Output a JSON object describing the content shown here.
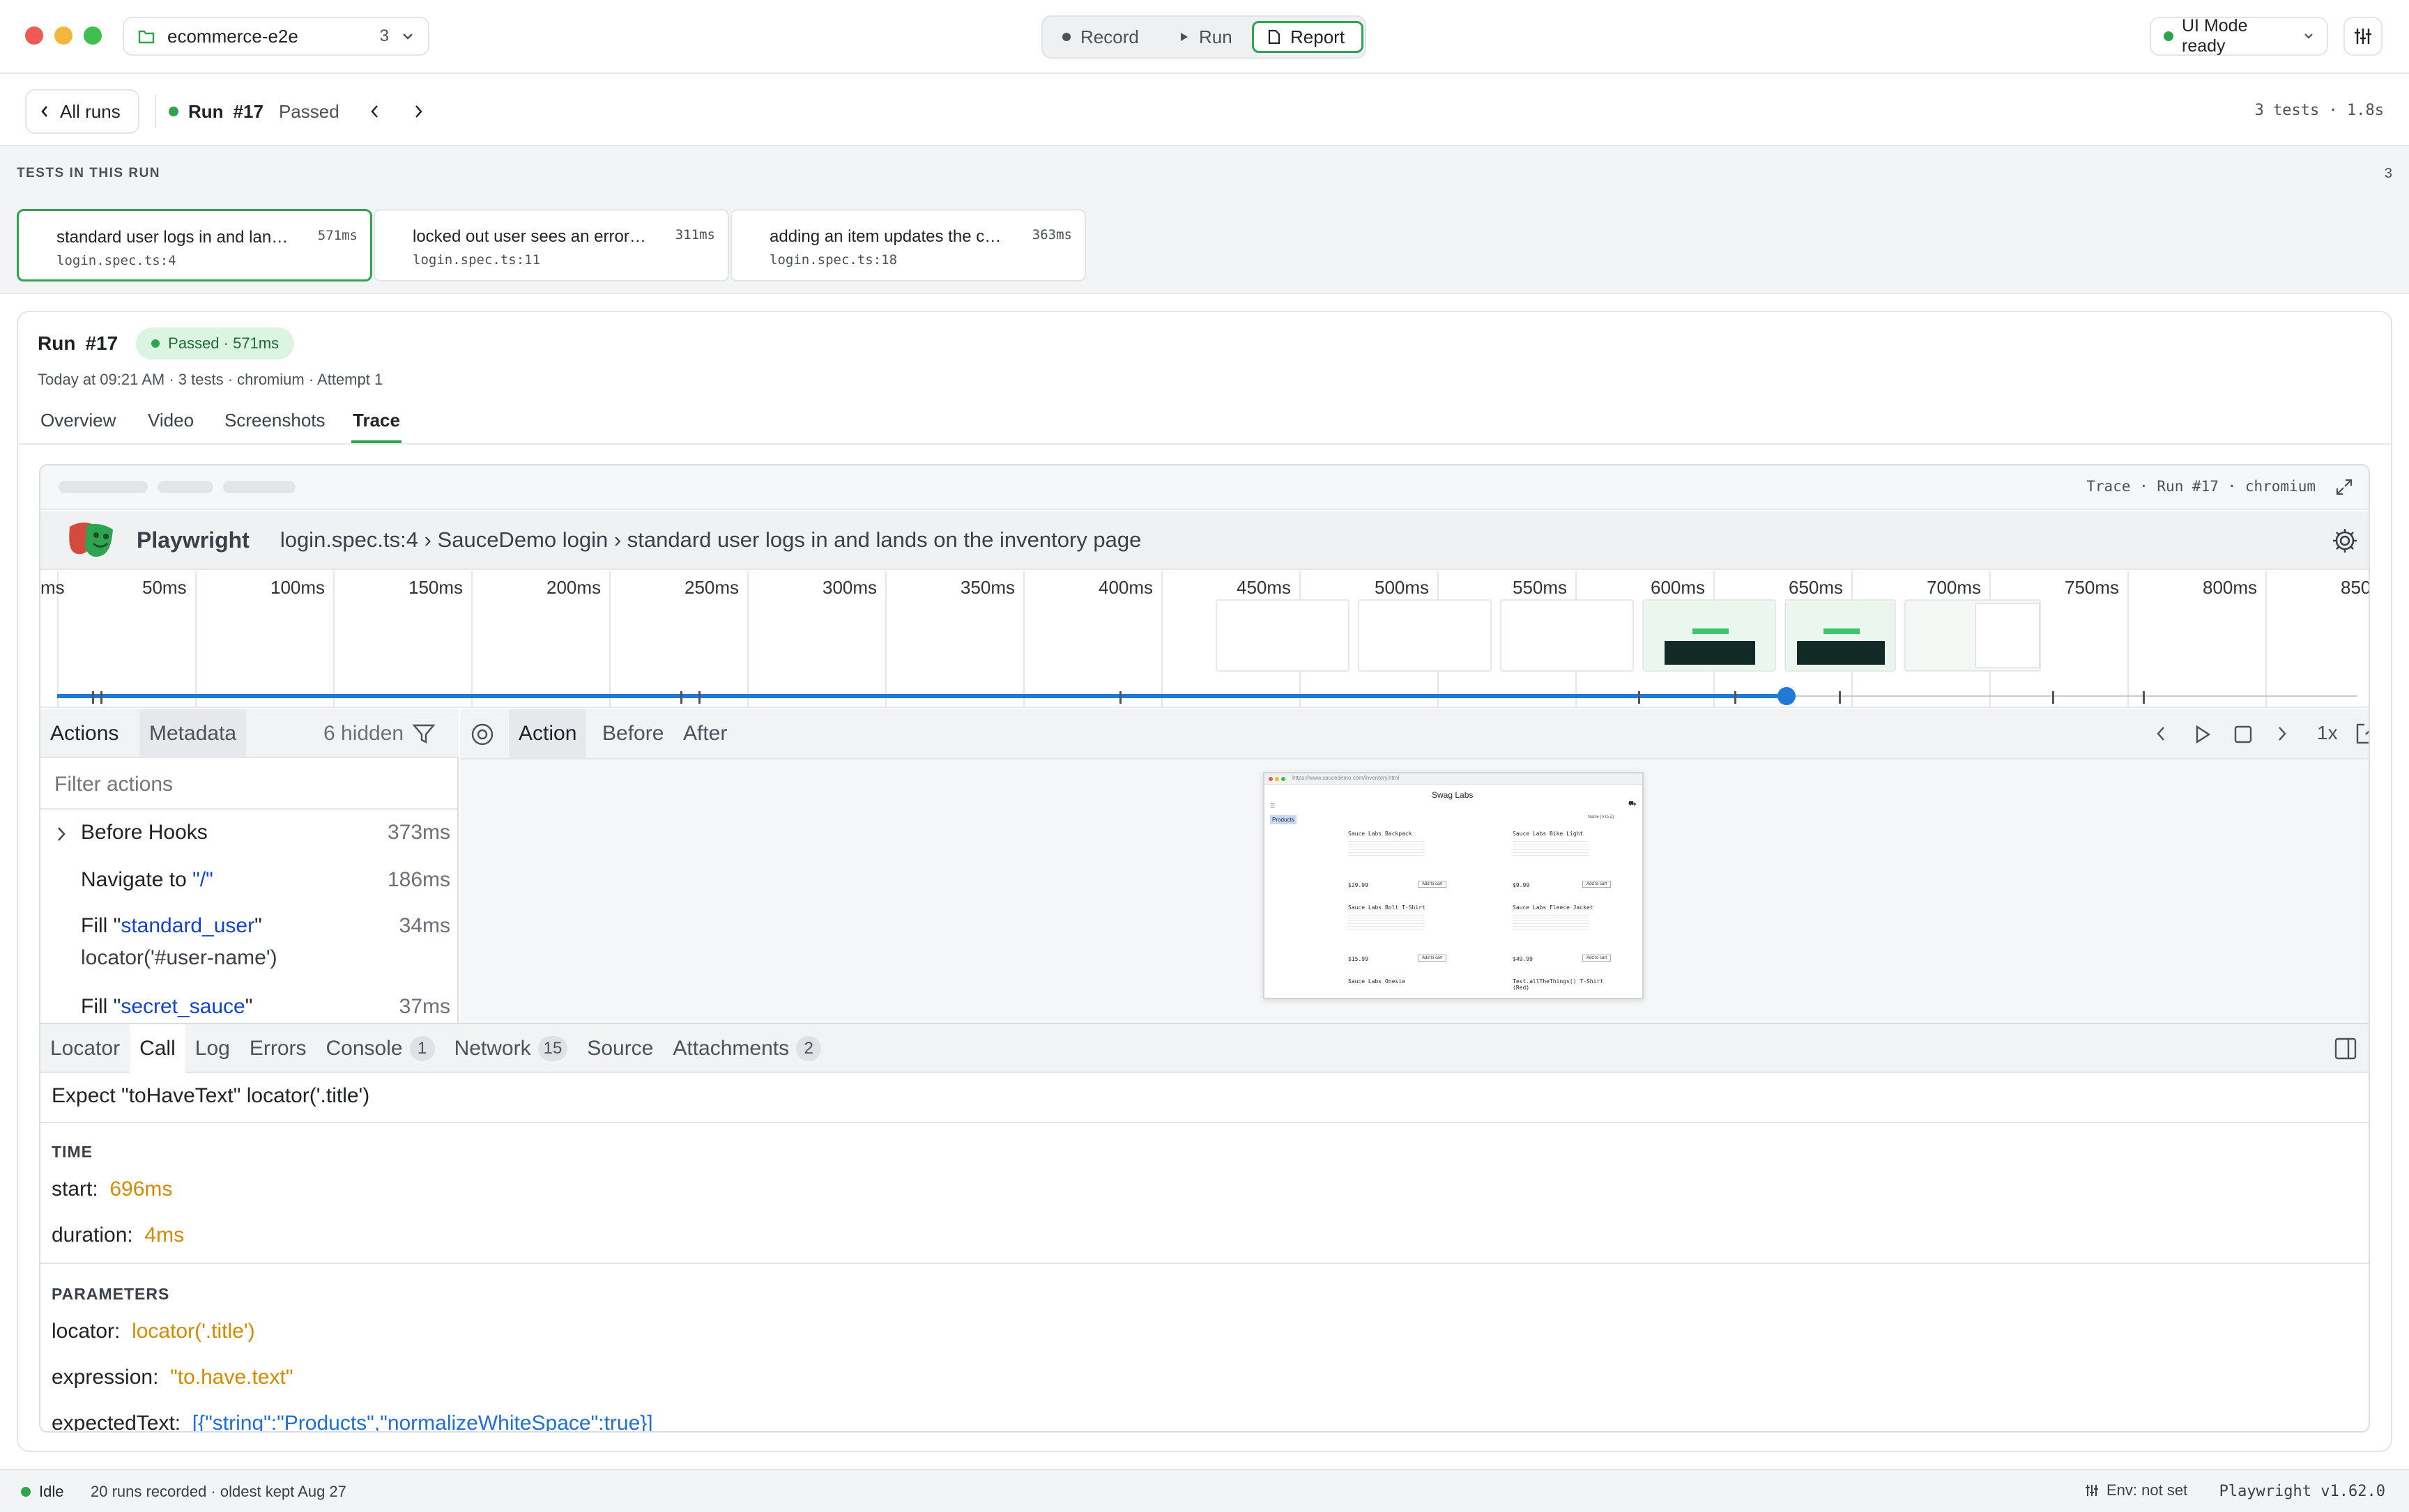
{
  "titlebar": {
    "project_name": "ecommerce-e2e",
    "project_count": "3",
    "modes": {
      "record": "Record",
      "run": "Run",
      "report": "Report"
    },
    "ui_mode": "UI Mode ready"
  },
  "runbar": {
    "back_label": "All runs",
    "run_label": "Run",
    "run_number": "#17",
    "run_status": "Passed",
    "summary": "3 tests · 1.8s"
  },
  "tests_section": {
    "heading": "TESTS IN THIS RUN",
    "count": "3",
    "tests": [
      {
        "name": "standard user logs in and lands on the inventory page",
        "file": "login.spec.ts:4",
        "duration": "571ms"
      },
      {
        "name": "locked out user sees an error message",
        "file": "login.spec.ts:11",
        "duration": "311ms"
      },
      {
        "name": "adding an item updates the cart badge",
        "file": "login.spec.ts:18",
        "duration": "363ms"
      }
    ]
  },
  "run_detail": {
    "title": "Run",
    "number": "#17",
    "badge": "Passed · 571ms",
    "meta": "Today at 09:21 AM · 3 tests · chromium · Attempt 1",
    "tabs": [
      "Overview",
      "Video",
      "Screenshots",
      "Trace"
    ],
    "active_tab": "Trace"
  },
  "trace": {
    "frame_label": "Trace · Run #17 · chromium",
    "app_name": "Playwright",
    "breadcrumb": "login.spec.ts:4 › SauceDemo login › standard user logs in and lands on the inventory page",
    "timeline_labels": [
      "ms",
      "50ms",
      "100ms",
      "150ms",
      "200ms",
      "250ms",
      "300ms",
      "350ms",
      "400ms",
      "450ms",
      "500ms",
      "550ms",
      "600ms",
      "650ms",
      "700ms",
      "750ms",
      "800ms",
      "850"
    ],
    "playhead_ms": 696,
    "left_tabs": {
      "actions": "Actions",
      "metadata": "Metadata",
      "hidden": "6 hidden"
    },
    "filter_placeholder": "Filter actions",
    "actions": [
      {
        "label": "Before Hooks",
        "time": "373ms"
      },
      {
        "label": "Navigate to ",
        "arg": "\"/\"",
        "time": "186ms"
      },
      {
        "label": "Fill \"",
        "arg": "standard_user",
        "tail": "\"",
        "time": "34ms",
        "sub": "locator('#user-name')"
      },
      {
        "label": "Fill \"",
        "arg": "secret_sauce",
        "tail": "\"",
        "time": "37ms"
      }
    ],
    "snapshot_tabs": [
      "Action",
      "Before",
      "After"
    ],
    "speed": "1x",
    "snapshot": {
      "url": "https://www.saucedemo.com/inventory.html",
      "brand": "Swag Labs",
      "section": "Products",
      "sort": "Name (A to Z)",
      "products": [
        {
          "name": "Sauce Labs Backpack",
          "price": "$29.99",
          "button": "Add to cart"
        },
        {
          "name": "Sauce Labs Bike Light",
          "price": "$9.99",
          "button": "Add to cart"
        },
        {
          "name": "Sauce Labs Bolt T-Shirt",
          "price": "$15.99",
          "button": "Add to cart"
        },
        {
          "name": "Sauce Labs Fleece Jacket",
          "price": "$49.99",
          "button": "Add to cart"
        },
        {
          "name": "Sauce Labs Onesie",
          "price": "",
          "button": ""
        },
        {
          "name": "Test.allTheThings() T-Shirt (Red)",
          "price": "",
          "button": ""
        }
      ]
    },
    "bottom_tabs": [
      {
        "label": "Locator"
      },
      {
        "label": "Call"
      },
      {
        "label": "Log"
      },
      {
        "label": "Errors"
      },
      {
        "label": "Console",
        "count": "1"
      },
      {
        "label": "Network",
        "count": "15"
      },
      {
        "label": "Source"
      },
      {
        "label": "Attachments",
        "count": "2"
      }
    ],
    "active_bottom_tab": "Call",
    "call": {
      "title": "Expect \"toHaveText\" locator('.title')",
      "time_heading": "TIME",
      "start_label": "start:",
      "start_value": "696ms",
      "duration_label": "duration:",
      "duration_value": "4ms",
      "params_heading": "PARAMETERS",
      "locator_label": "locator:",
      "locator_value": "locator('.title')",
      "expression_label": "expression:",
      "expression_value": "\"to.have.text\"",
      "expected_label": "expectedText:",
      "expected_value": "[{\"string\":\"Products\",\"normalizeWhiteSpace\":true}]"
    }
  },
  "statusbar": {
    "state": "Idle",
    "runs": "20 runs recorded · oldest kept Aug 27",
    "env": "Env: not set",
    "version": "Playwright v1.62.0"
  },
  "colors": {
    "accent_green": "#2fa34f",
    "timeline_blue": "#1f7ad6",
    "param_orange": "#d28a00"
  }
}
